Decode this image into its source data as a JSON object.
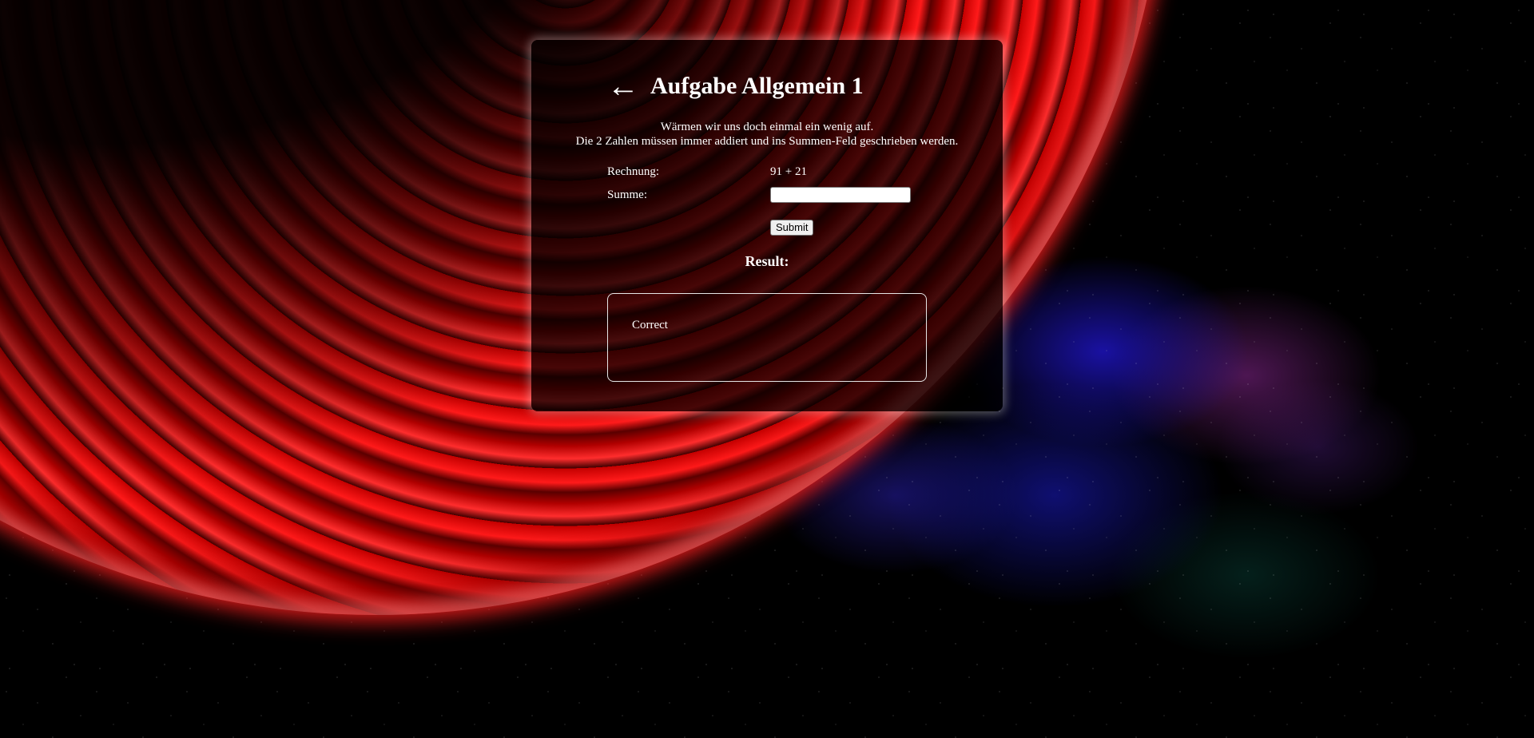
{
  "header": {
    "back_arrow": "←",
    "title": "Aufgabe Allgemein 1"
  },
  "intro": {
    "line1": "Wärmen wir uns doch einmal ein wenig auf.",
    "line2": "Die 2 Zahlen müssen immer addiert und ins Summen-Feld geschrieben werden."
  },
  "form": {
    "calculation_label": "Rechnung:",
    "calculation_value": "91 + 21",
    "sum_label": "Summe:",
    "sum_value": "",
    "submit_label": "Submit"
  },
  "result": {
    "heading": "Result:",
    "message": "Correct"
  },
  "colors": {
    "planet": "#d00000",
    "panel_background": "#000000",
    "text": "#ffffff"
  }
}
